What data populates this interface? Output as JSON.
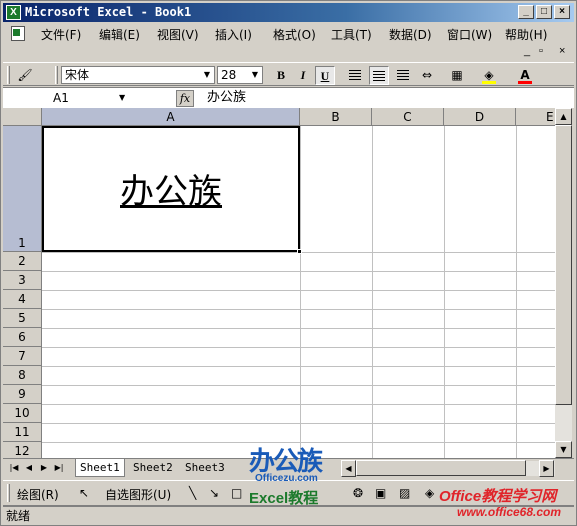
{
  "window": {
    "title": "Microsoft Excel - Book1",
    "app_icon": "excel-icon"
  },
  "menubar": {
    "items": [
      "文件(F)",
      "编辑(E)",
      "视图(V)",
      "插入(I)",
      "格式(O)",
      "工具(T)",
      "数据(D)",
      "窗口(W)",
      "帮助(H)"
    ]
  },
  "format_toolbar": {
    "font_name": "宋体",
    "font_size": "28",
    "bold": "B",
    "italic": "I",
    "underline": "U",
    "underline_active": true,
    "fill_color": "#ffff00",
    "font_color": "#ff0000"
  },
  "formula_bar": {
    "name_box": "A1",
    "fx_label": "fx",
    "content": "办公族"
  },
  "grid": {
    "columns": [
      "A",
      "B",
      "C",
      "D",
      "E"
    ],
    "rows": [
      "1",
      "2",
      "3",
      "4",
      "5",
      "6",
      "7",
      "8",
      "9",
      "10",
      "11",
      "12"
    ],
    "selected_cell": "A1",
    "cell_a1": "办公族"
  },
  "sheets": {
    "tabs": [
      "Sheet1",
      "Sheet2",
      "Sheet3"
    ],
    "active": "Sheet1"
  },
  "drawing_toolbar": {
    "draw_label": "绘图(R)",
    "autoshape_label": "自选图形(U)"
  },
  "status": {
    "text": "就绪"
  },
  "watermark": {
    "brand": "办公族",
    "site": "Officezu.com",
    "tag": "Excel教程",
    "right_title": "Office教程学习网",
    "right_url": "www.office68.com"
  }
}
